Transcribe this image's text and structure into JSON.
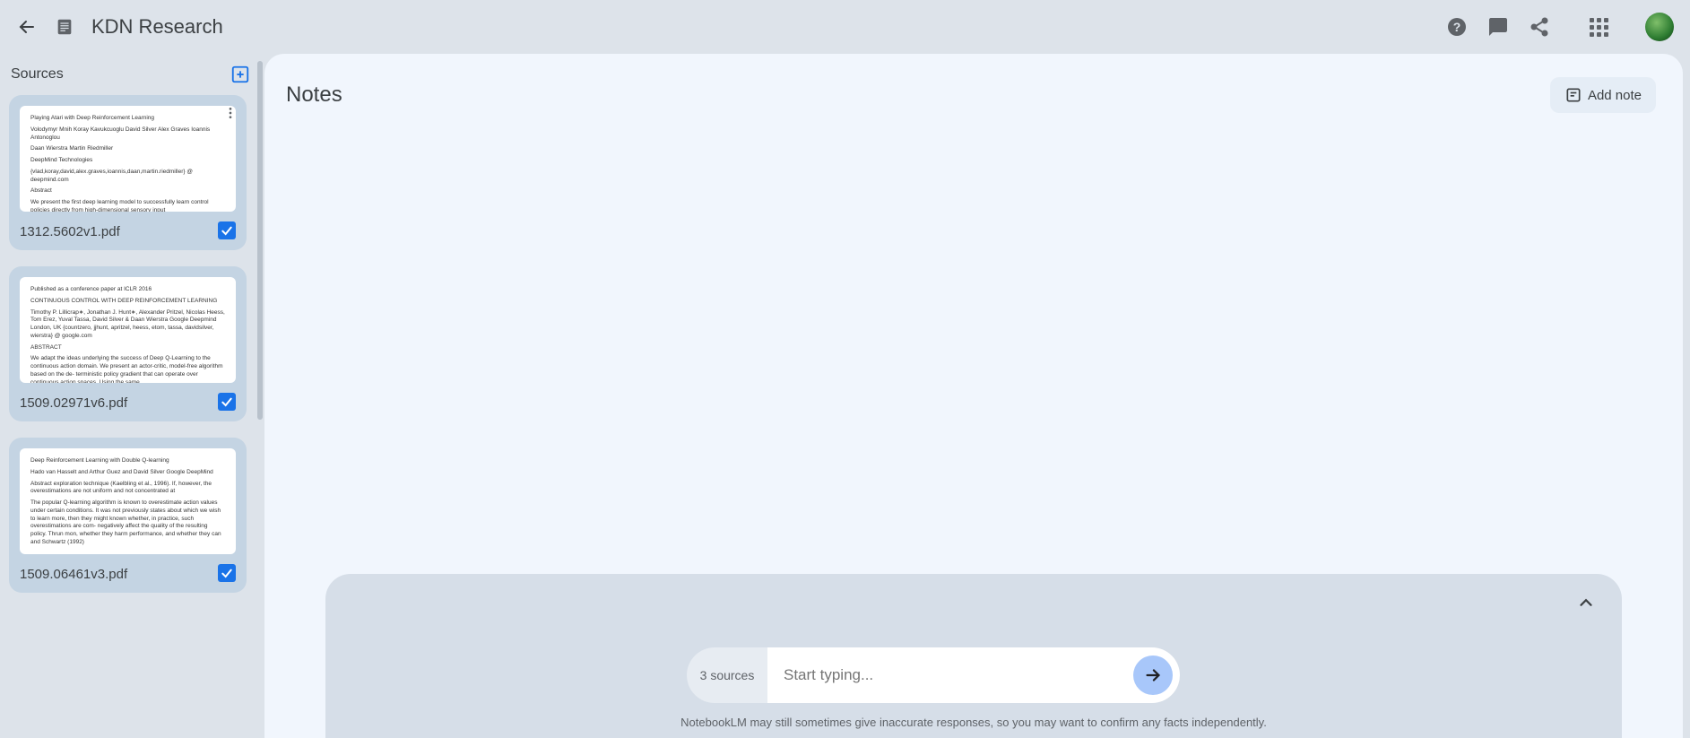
{
  "header": {
    "title": "KDN Research"
  },
  "sidebar": {
    "title": "Sources",
    "sources": [
      {
        "filename": "1312.5602v1.pdf",
        "checked": true,
        "preview": [
          "Playing Atari with Deep Reinforcement Learning",
          "Volodymyr Mnih Koray Kavukcuoglu David Silver Alex Graves Ioannis Antonoglou",
          "Daan Wierstra Martin Riedmiller",
          "DeepMind Technologies",
          "{vlad,koray,david,alex.graves,ioannis,daan,martin.riedmiller} @ deepmind.com",
          "Abstract",
          "We present the first deep learning model to successfully learn control policies directly from high-dimensional sensory input"
        ]
      },
      {
        "filename": "1509.02971v6.pdf",
        "checked": true,
        "preview": [
          "Published as a conference paper at ICLR 2016",
          "CONTINUOUS CONTROL WITH DEEP REINFORCEMENT LEARNING",
          "Timothy P. Lillicrap∗, Jonathan J. Hunt∗, Alexander Pritzel, Nicolas Heess, Tom Erez, Yuval Tassa, David Silver & Daan Wierstra Google Deepmind London, UK {countzero, jjhunt, apritzel, heess, etom, tassa, davidsilver, wierstra} @ google.com",
          "ABSTRACT",
          "We adapt the ideas underlying the success of Deep Q-Learning to the continuous action domain. We present an actor-critic, model-free algorithm based on the de- terministic policy gradient that can operate over continuous action spaces. Using the same"
        ]
      },
      {
        "filename": "1509.06461v3.pdf",
        "checked": true,
        "preview": [
          "Deep Reinforcement Learning with Double Q-learning",
          "Hado van Hasselt and Arthur Guez and David Silver Google DeepMind",
          "Abstract exploration technique (Kaelbling et al., 1996). If, however, the overestimations are not uniform and not concentrated at",
          "The popular Q-learning algorithm is known to overestimate action values under certain conditions. It was not previously states about which we wish to learn more, then they might known whether, in practice, such overestimations are com- negatively affect the quality of the resulting policy. Thrun mon, whether they harm performance, and whether they can and Schwartz (1992)"
        ]
      }
    ]
  },
  "notes": {
    "title": "Notes",
    "add_note_label": "Add note"
  },
  "chat": {
    "source_count_label": "3 sources",
    "placeholder": "Start typing...",
    "disclaimer": "NotebookLM may still sometimes give inaccurate responses, so you may want to confirm any facts independently."
  }
}
